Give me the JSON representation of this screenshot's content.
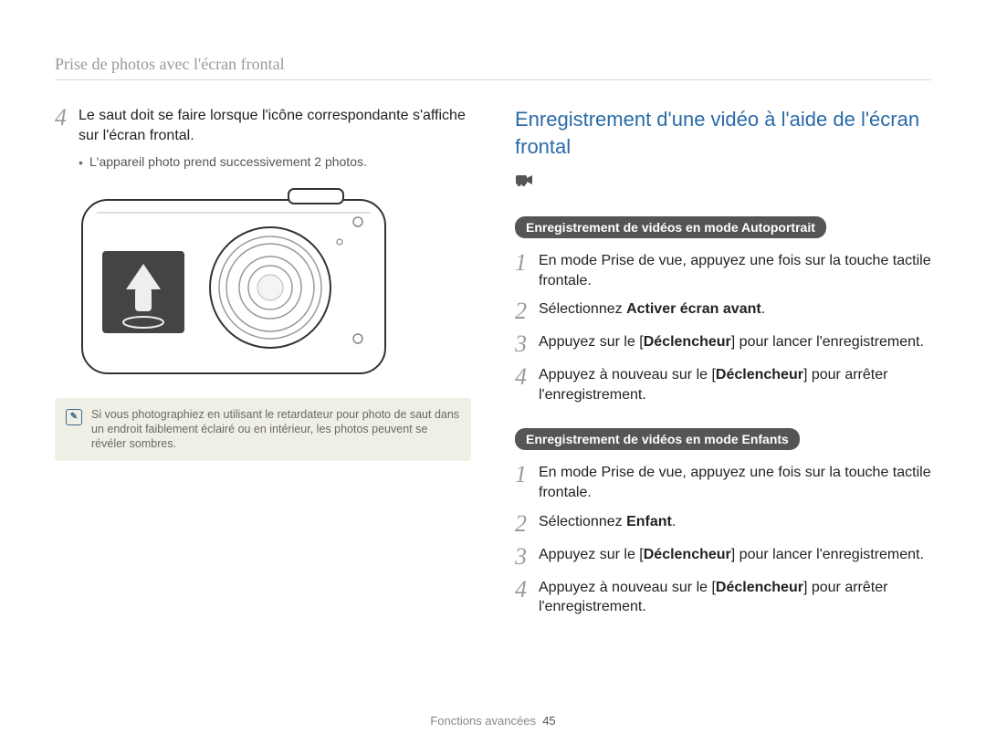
{
  "header": {
    "sectionTitle": "Prise de photos avec l'écran frontal"
  },
  "left": {
    "step4_num": "4",
    "step4_text": "Le saut doit se faire lorsque l'icône correspondante s'affiche sur l'écran frontal.",
    "bullet": "L'appareil photo prend successivement 2 photos.",
    "note": "Si vous photographiez en utilisant le retardateur pour photo de saut dans un endroit faiblement éclairé ou en intérieur, les photos peuvent se révéler sombres."
  },
  "right": {
    "heading": "Enregistrement d'une vidéo à l'aide de l'écran frontal",
    "pillA": "Enregistrement de vidéos en mode Autoportrait",
    "groupA": {
      "s1_num": "1",
      "s1_text": "En mode Prise de vue, appuyez une fois sur la touche tactile frontale.",
      "s2_num": "2",
      "s2_pre": "Sélectionnez ",
      "s2_bold": "Activer écran avant",
      "s2_post": ".",
      "s3_num": "3",
      "s3_pre": "Appuyez sur le [",
      "s3_bold": "Déclencheur",
      "s3_post": "] pour lancer l'enregistrement.",
      "s4_num": "4",
      "s4_pre": "Appuyez à nouveau sur le [",
      "s4_bold": "Déclencheur",
      "s4_post": "] pour arrêter l'enregistrement."
    },
    "pillB": "Enregistrement de vidéos en mode Enfants",
    "groupB": {
      "s1_num": "1",
      "s1_text": "En mode Prise de vue, appuyez une fois sur la touche tactile frontale.",
      "s2_num": "2",
      "s2_pre": "Sélectionnez ",
      "s2_bold": "Enfant",
      "s2_post": ".",
      "s3_num": "3",
      "s3_pre": "Appuyez sur le [",
      "s3_bold": "Déclencheur",
      "s3_post": "] pour lancer l'enregistrement.",
      "s4_num": "4",
      "s4_pre": "Appuyez à nouveau sur le [",
      "s4_bold": "Déclencheur",
      "s4_post": "] pour arrêter l'enregistrement."
    }
  },
  "footer": {
    "label": "Fonctions avancées",
    "page": "45"
  }
}
